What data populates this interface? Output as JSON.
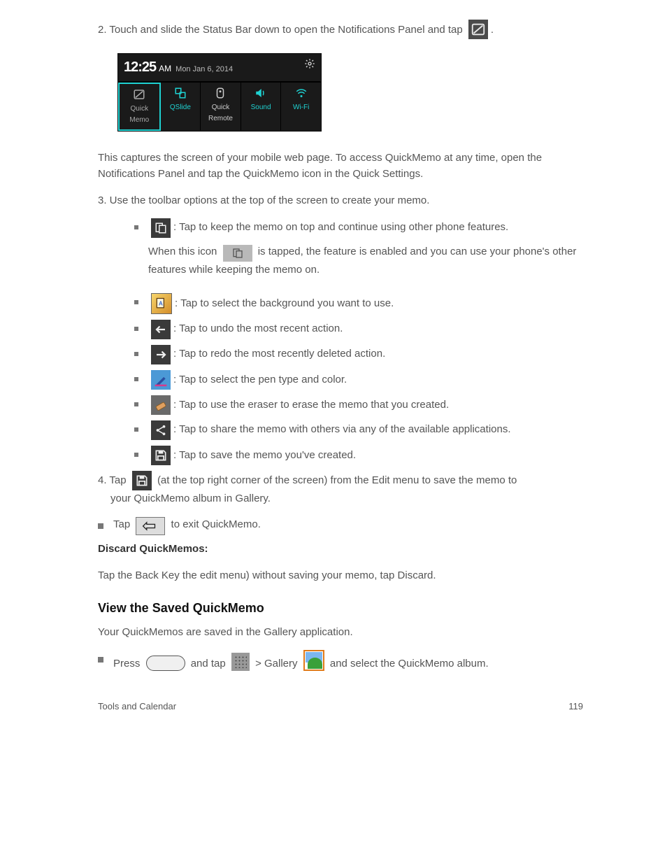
{
  "intro1": "2. Touch and slide the Status Bar down to open the Notifications Panel and tap ",
  "intro2_a": "This captures the screen of your mobile web page. To access QuickMemo at any time, open the",
  "intro2_b": "Notifications Panel and tap the QuickMemo icon in the Quick Settings.",
  "intro3": "3. Use the toolbar options at the top of the screen to create your memo.",
  "overlay": ": Tap to keep the memo on top and continue using other phone features.",
  "overlay2a": "When this icon ",
  "overlay2b": " is tapped, the feature is enabled and you can use your phone's other",
  "overlay2c": "features while keeping the memo on.",
  "background": ": Tap to select the background you want to use.",
  "undo": ": Tap to undo the most recent action.",
  "redo": ": Tap to redo the most recently deleted action.",
  "pen": ": Tap to select the pen type and color.",
  "eraser": ": Tap to use the eraser to erase the memo that you created.",
  "share": ": Tap to share the memo with others via any of the available applications.",
  "save": ": Tap to save the memo you've created.",
  "step4a": "4. Tap ",
  "step4b": " (at the top right corner of the screen) from the Edit menu to save the memo to",
  "step4c": "your QuickMemo album in Gallery.",
  "exit_bullet_a": "Tap ",
  "exit_bullet_b": " to exit QuickMemo.",
  "discard_heading": "Discard QuickMemos:",
  "discard_text": "Tap the Back Key the edit menu) without saving your memo, tap Discard.",
  "view_heading": "View the Saved QuickMemo",
  "view_text": "Your QuickMemos are saved in the Gallery application.",
  "gallery1a": "Press ",
  "gallery1b": " and tap ",
  "gallery1c": " > Gallery ",
  "gallery1d": " and select the QuickMemo album.",
  "notif": {
    "time": "12:25",
    "ampm": "AM",
    "date": "Mon Jan 6, 2014",
    "toggles": [
      "Quick Memo",
      "QSlide",
      "Quick Remote",
      "Sound",
      "Wi-Fi"
    ]
  },
  "footer_left": "Tools and Calendar",
  "footer_right": "119"
}
